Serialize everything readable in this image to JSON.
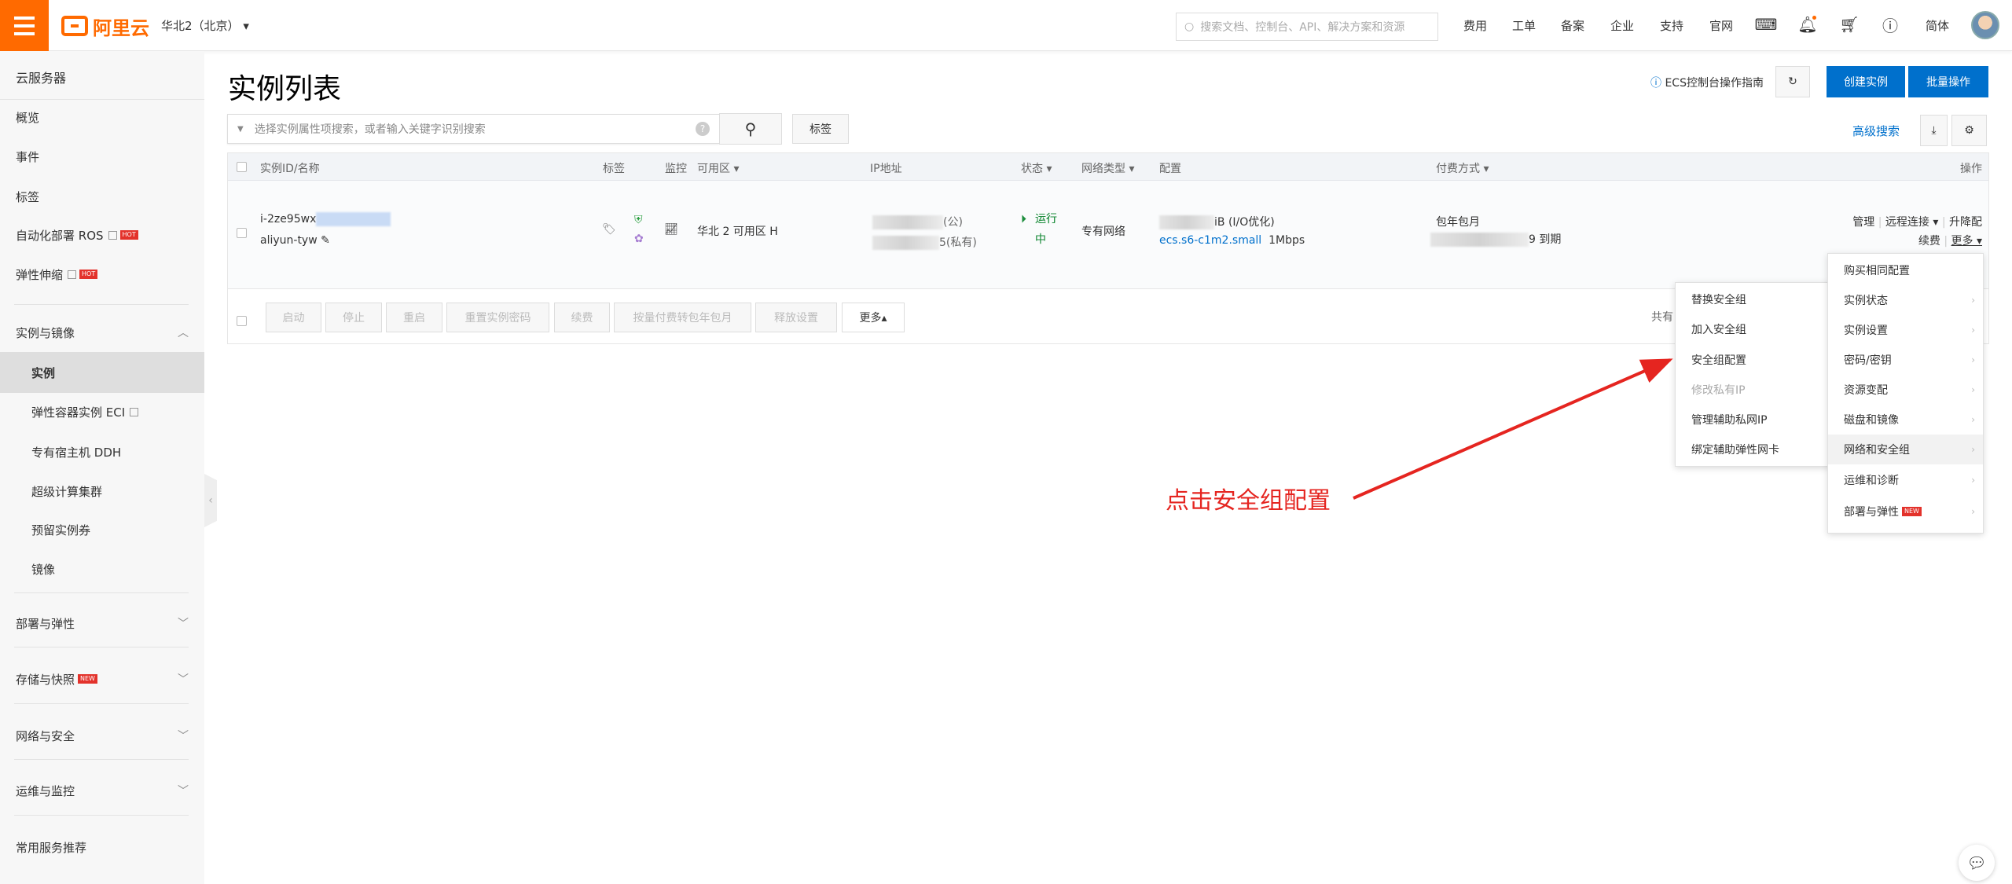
{
  "header": {
    "region": "华北2（北京）",
    "search_placeholder": "搜索文档、控制台、API、解决方案和资源",
    "nav": [
      "费用",
      "工单",
      "备案",
      "企业",
      "支持",
      "官网"
    ],
    "lang": "简体",
    "brand": "阿里云",
    "brand_color": "#ff6a00"
  },
  "sidebar": {
    "title": "云服务器",
    "items": [
      {
        "label": "概览"
      },
      {
        "label": "事件"
      },
      {
        "label": "标签"
      },
      {
        "label": "自动化部署 ROS",
        "badge": "HOT"
      },
      {
        "label": "弹性伸缩",
        "badge": "HOT"
      },
      {
        "label": "实例与镜像"
      },
      {
        "label": "实例"
      },
      {
        "label": "弹性容器实例 ECI"
      },
      {
        "label": "专有宿主机 DDH"
      },
      {
        "label": "超级计算集群"
      },
      {
        "label": "预留实例券"
      },
      {
        "label": "镜像"
      },
      {
        "label": "部署与弹性"
      },
      {
        "label": "存储与快照",
        "badge": "NEW"
      },
      {
        "label": "网络与安全"
      },
      {
        "label": "运维与监控"
      },
      {
        "label": "常用服务推荐"
      }
    ]
  },
  "page": {
    "title": "实例列表",
    "guide": "ECS控制台操作指南",
    "create": "创建实例",
    "batch": "批量操作",
    "search_placeholder": "选择实例属性项搜索，或者输入关键字识别搜索",
    "tag_button": "标签",
    "advanced": "高级搜索",
    "accent": "#0070cc"
  },
  "table": {
    "headers": [
      "实例ID/名称",
      "标签",
      "监控",
      "可用区 ▾",
      "IP地址",
      "状态 ▾",
      "网络类型 ▾",
      "配置",
      "付费方式 ▾",
      "操作"
    ],
    "row": {
      "id": "i-2ze95wx",
      "name": "aliyun-tyw",
      "zone": "华北 2 可用区 H",
      "ip_public": "(公)",
      "ip_private": "5(私有)",
      "status": "运行中",
      "status_a": "运行",
      "status_b": "中",
      "network": "专有网络",
      "config1": "iB (I/O优化)",
      "config_type": "ecs.s6-c1m2.small",
      "bandwidth": "1Mbps",
      "pay": "包年包月",
      "expire": "9 到期",
      "actions": {
        "manage": "管理",
        "remote": "远程连接 ▾",
        "upgrade": "升降配",
        "renew": "续费",
        "more": "更多 ▾"
      }
    },
    "footer_buttons": [
      "启动",
      "停止",
      "重启",
      "重置实例密码",
      "续费",
      "按量付费转包年包月",
      "释放设置"
    ],
    "footer_more": "更多▴",
    "total": "共有"
  },
  "more_menu": [
    {
      "label": "购买相同配置"
    },
    {
      "label": "实例状态"
    },
    {
      "label": "实例设置"
    },
    {
      "label": "密码/密钥"
    },
    {
      "label": "资源变配"
    },
    {
      "label": "磁盘和镜像"
    },
    {
      "label": "网络和安全组",
      "highlighted": true
    },
    {
      "label": "运维和诊断"
    },
    {
      "label": "部署与弹性",
      "badge": "NEW"
    }
  ],
  "sub_menu": [
    {
      "label": "替换安全组"
    },
    {
      "label": "加入安全组"
    },
    {
      "label": "安全组配置"
    },
    {
      "label": "修改私有IP",
      "disabled": true
    },
    {
      "label": "管理辅助私网IP"
    },
    {
      "label": "绑定辅助弹性网卡"
    }
  ],
  "annotation": {
    "text": "点击安全组配置",
    "color": "#e52520"
  }
}
